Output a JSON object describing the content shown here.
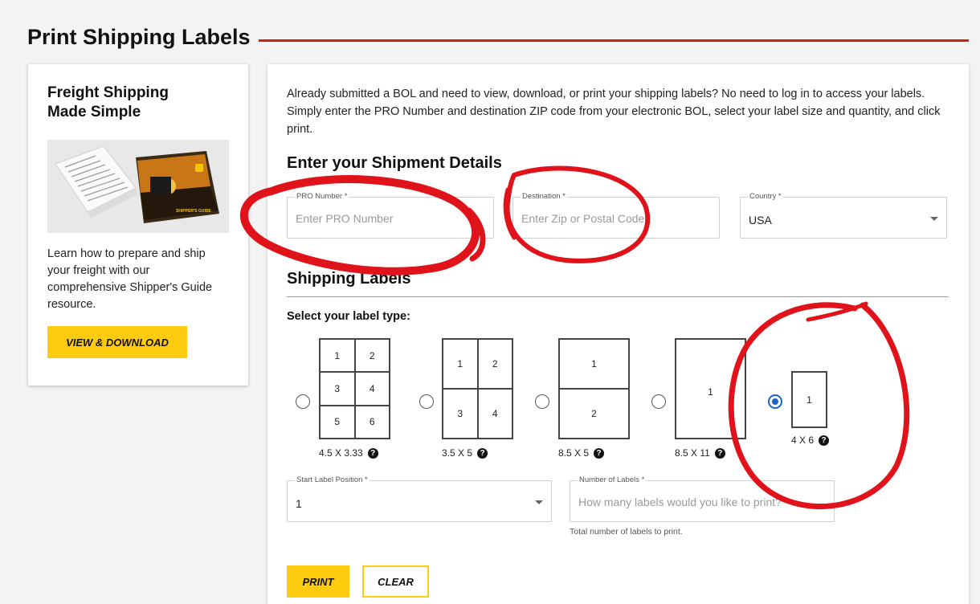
{
  "page": {
    "title": "Print Shipping Labels"
  },
  "promo": {
    "heading": "Freight Shipping Made Simple",
    "image_caption": "SHIPPER'S GUIDE",
    "body": "Learn how to prepare and ship your freight with our comprehensive Shipper's Guide resource.",
    "button_label": "VIEW & DOWNLOAD"
  },
  "intro": "Already submitted a BOL and need to view, download, or print your shipping labels? No need to log in to access your labels. Simply enter the PRO Number and destination ZIP code from your electronic BOL, select your label size and quantity, and click print.",
  "shipment": {
    "heading": "Enter your Shipment Details",
    "pro_label": "PRO Number *",
    "pro_placeholder": "Enter PRO Number",
    "dest_label": "Destination *",
    "dest_placeholder": "Enter Zip or Postal Code",
    "country_label": "Country *",
    "country_value": "USA"
  },
  "labels": {
    "heading": "Shipping Labels",
    "select_label": "Select your label type:",
    "types": [
      {
        "caption": "4.5 X 3.33",
        "cells": [
          "1",
          "2",
          "3",
          "4",
          "5",
          "6"
        ],
        "selected": false
      },
      {
        "caption": "3.5 X 5",
        "cells": [
          "1",
          "2",
          "3",
          "4"
        ],
        "selected": false
      },
      {
        "caption": "8.5 X 5",
        "cells": [
          "1",
          "2"
        ],
        "selected": false
      },
      {
        "caption": "8.5 X 11",
        "cells": [
          "1"
        ],
        "selected": false
      },
      {
        "caption": "4 X 6",
        "cells": [
          "1"
        ],
        "selected": true
      }
    ],
    "help_glyph": "?",
    "start_position_label": "Start Label Position *",
    "start_position_value": "1",
    "count_label": "Number of Labels *",
    "count_placeholder": "How many labels would you like to print?",
    "count_helper": "Total number of labels to print."
  },
  "actions": {
    "print_label": "PRINT",
    "clear_label": "CLEAR"
  },
  "colors": {
    "accent_red": "#d2200f",
    "button_yellow": "#fecb0f",
    "radio_blue": "#1a63d0",
    "annotation_red": "#e0121a"
  }
}
